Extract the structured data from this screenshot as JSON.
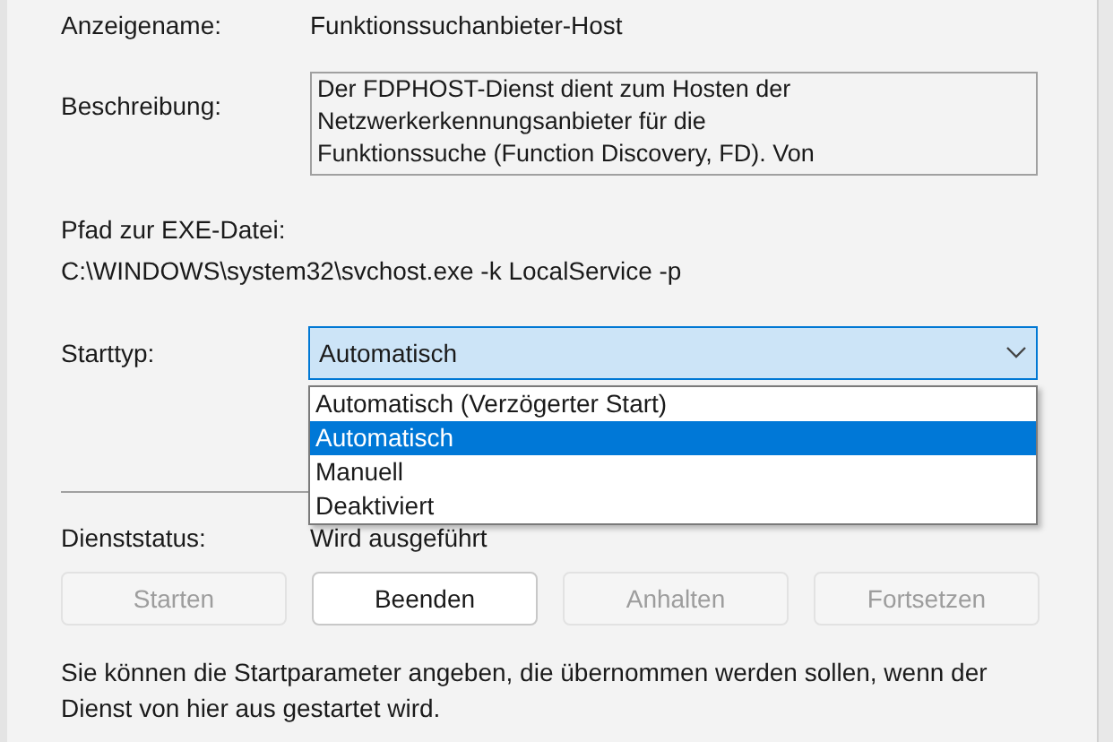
{
  "display_name": {
    "label": "Anzeigename:",
    "value": "Funktionssuchanbieter-Host"
  },
  "description": {
    "label": "Beschreibung:",
    "value": "Der FDPHOST-Dienst dient zum Hosten der Netzwerkerkennungsanbieter für die Funktionssuche (Function Discovery, FD). Von"
  },
  "exe_path": {
    "label": "Pfad zur EXE-Datei:",
    "value": "C:\\WINDOWS\\system32\\svchost.exe -k LocalService -p"
  },
  "startup_type": {
    "label": "Starttyp:",
    "value": "Automatisch",
    "expanded": true,
    "options": [
      {
        "label": "Automatisch (Verzögerter Start)",
        "selected": false
      },
      {
        "label": "Automatisch",
        "selected": true
      },
      {
        "label": "Manuell",
        "selected": false
      },
      {
        "label": "Deaktiviert",
        "selected": false
      }
    ]
  },
  "service_status": {
    "label": "Dienststatus:",
    "value": "Wird ausgeführt"
  },
  "buttons": [
    {
      "label": "Starten",
      "disabled": true
    },
    {
      "label": "Beenden",
      "disabled": false
    },
    {
      "label": "Anhalten",
      "disabled": true
    },
    {
      "label": "Fortsetzen",
      "disabled": true
    }
  ],
  "hint": "Sie können die Startparameter angeben, die übernommen werden sollen, wenn der Dienst von hier aus gestartet wird."
}
